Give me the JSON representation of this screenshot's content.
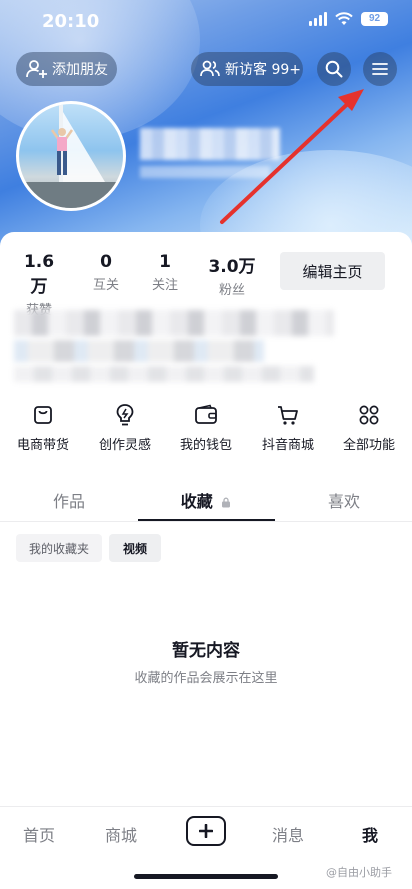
{
  "status_bar": {
    "time": "20:10",
    "battery": "92"
  },
  "top_bar": {
    "add_friend_label": "添加朋友",
    "visitors_label": "新访客 99+"
  },
  "stats": [
    {
      "value": "1.6万",
      "label": "获赞"
    },
    {
      "value": "0",
      "label": "互关"
    },
    {
      "value": "1",
      "label": "关注"
    },
    {
      "value": "3.0万",
      "label": "粉丝"
    }
  ],
  "edit_profile_label": "编辑主页",
  "features": [
    {
      "label": "电商带货",
      "icon": "shopping-bag-icon"
    },
    {
      "label": "创作灵感",
      "icon": "lightbulb-icon"
    },
    {
      "label": "我的钱包",
      "icon": "wallet-icon"
    },
    {
      "label": "抖音商城",
      "icon": "cart-icon"
    },
    {
      "label": "全部功能",
      "icon": "grid-icon"
    }
  ],
  "tabs": [
    {
      "label": "作品"
    },
    {
      "label": "收藏",
      "locked": true
    },
    {
      "label": "喜欢"
    }
  ],
  "filter_chips": {
    "folder": "我的收藏夹",
    "video": "视频"
  },
  "empty_state": {
    "title": "暂无内容",
    "subtitle": "收藏的作品会展示在这里"
  },
  "bottom_nav": {
    "home": "首页",
    "mall": "商城",
    "messages": "消息",
    "me": "我"
  },
  "watermark": "@自由小助手",
  "colors": {
    "accent_arrow": "#e5322d",
    "text_primary": "#161823",
    "text_secondary": "#7d7f86"
  }
}
